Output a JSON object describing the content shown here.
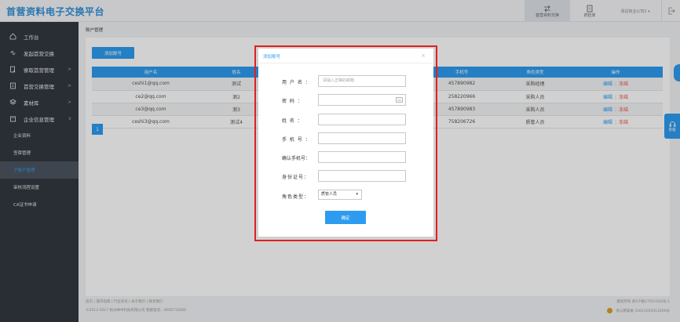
{
  "header": {
    "logo": "首营资料电子交换平台",
    "exchange_label": "首营资料交换",
    "todo_label": "药检单",
    "company": "测试商业公司2 ▾"
  },
  "sidebar": {
    "items": [
      {
        "label": "工作台",
        "icon": "home-icon"
      },
      {
        "label": "发起首营交换",
        "icon": "link-icon"
      },
      {
        "label": "索取首营管理",
        "icon": "request-icon",
        "arrow": ">"
      },
      {
        "label": "首营交换管理",
        "icon": "document-icon",
        "arrow": ">"
      },
      {
        "label": "素材库",
        "icon": "layers-icon",
        "arrow": ">"
      },
      {
        "label": "企业信息管理",
        "icon": "building-icon",
        "arrow": "∨"
      }
    ],
    "subitems": [
      "企业资料",
      "签章管理",
      "子账户管理",
      "审核流程设置",
      "CA证书申请"
    ],
    "active_sub": "子账户管理"
  },
  "main": {
    "breadcrumb": "账户管理",
    "add_button": "添加账号",
    "table": {
      "headers": [
        "用户名",
        "姓名",
        "",
        "手机号",
        "角色类型",
        "操作"
      ],
      "rows": [
        {
          "username": "ceshi1@qq.com",
          "name": "测试",
          "phone": "457890982",
          "role": "采购经理"
        },
        {
          "username": "ce2@qq.com",
          "name": "测2",
          "phone": "258220966",
          "role": "采购人员"
        },
        {
          "username": "ce3@qq.com",
          "name": "测3",
          "phone": "457890983",
          "role": "采购人员"
        },
        {
          "username": "ceshi3@qq.com",
          "name": "测试4",
          "phone": "758206726",
          "role": "质管人员"
        }
      ],
      "edit_label": "编辑",
      "sep": "|",
      "delete_label": "冻结"
    },
    "page": "1"
  },
  "footer": {
    "links": "首页 | 操作指南 | 行业资讯 | 关于我们 | 联系我们",
    "copyright": "©2013-2017 杭州婵中科技有限公司  客服电话：4006715006",
    "icp": "版权所有 浙ICP备17021164号-1",
    "police": "浙公网安备 33011002013266号"
  },
  "modal": {
    "title": "添加账号",
    "close": "×",
    "fields": [
      {
        "label": "用 户 名 ：",
        "placeholder": "请输入正确的邮箱"
      },
      {
        "label": "密    码 ：",
        "placeholder": ""
      },
      {
        "label": "姓    名 ：",
        "placeholder": ""
      },
      {
        "label": "手 机 号 ：",
        "placeholder": ""
      },
      {
        "label": "确认手机号：",
        "placeholder": ""
      },
      {
        "label": "身份证号：",
        "placeholder": ""
      }
    ],
    "role_label": "角色类型：",
    "role_value": "质管人员",
    "role_caret": "▾",
    "confirm": "确定"
  },
  "float": {
    "service_label": "客服"
  },
  "colors": {
    "accent": "#2d9cf0",
    "sidebar_bg": "#333840",
    "danger": "#e84b3c",
    "highlight_border": "#e02020"
  }
}
